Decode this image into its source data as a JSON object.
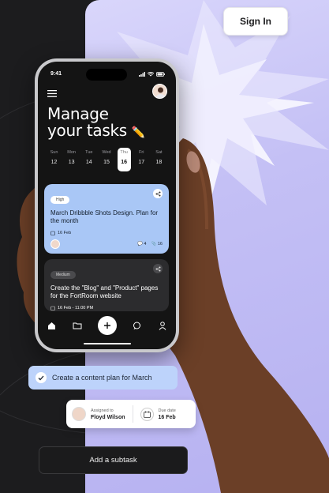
{
  "header": {
    "sign_in_label": "Sign In"
  },
  "phone": {
    "status_time": "9:41",
    "title_line1": "Manage",
    "title_line2": "your tasks",
    "week": [
      {
        "day": "Sun",
        "date": "12",
        "active": false
      },
      {
        "day": "Mon",
        "date": "13",
        "active": false
      },
      {
        "day": "Tue",
        "date": "14",
        "active": false
      },
      {
        "day": "Wed",
        "date": "15",
        "active": false
      },
      {
        "day": "Thu",
        "date": "16",
        "active": true
      },
      {
        "day": "Fri",
        "date": "17",
        "active": false
      },
      {
        "day": "Sat",
        "date": "18",
        "active": false
      }
    ],
    "cards": [
      {
        "badge": "High",
        "title": "March Dribbble Shots Design. Plan for the month",
        "date": "16 Feb",
        "comments": "4",
        "attachments": "16",
        "color": "#a9c7f6"
      },
      {
        "badge": "Medium",
        "title": "Create the \"Blog\" and \"Product\" pages for the FortRoom website",
        "date": "16 Feb - 11:00 PM",
        "color": "#2c2c2e"
      }
    ]
  },
  "task_pill": {
    "label": "Create a content plan for March"
  },
  "assign_card": {
    "assigned_label": "Assigned to",
    "assignee": "Floyd Wilson",
    "due_label": "Due date",
    "due_value": "16 Feb"
  },
  "subtask_button": {
    "label": "Add a subtask"
  },
  "colors": {
    "accent_lavender": "#c4c0f5",
    "card_blue": "#a9c7f6",
    "dark_bg": "#1c1c1e"
  }
}
